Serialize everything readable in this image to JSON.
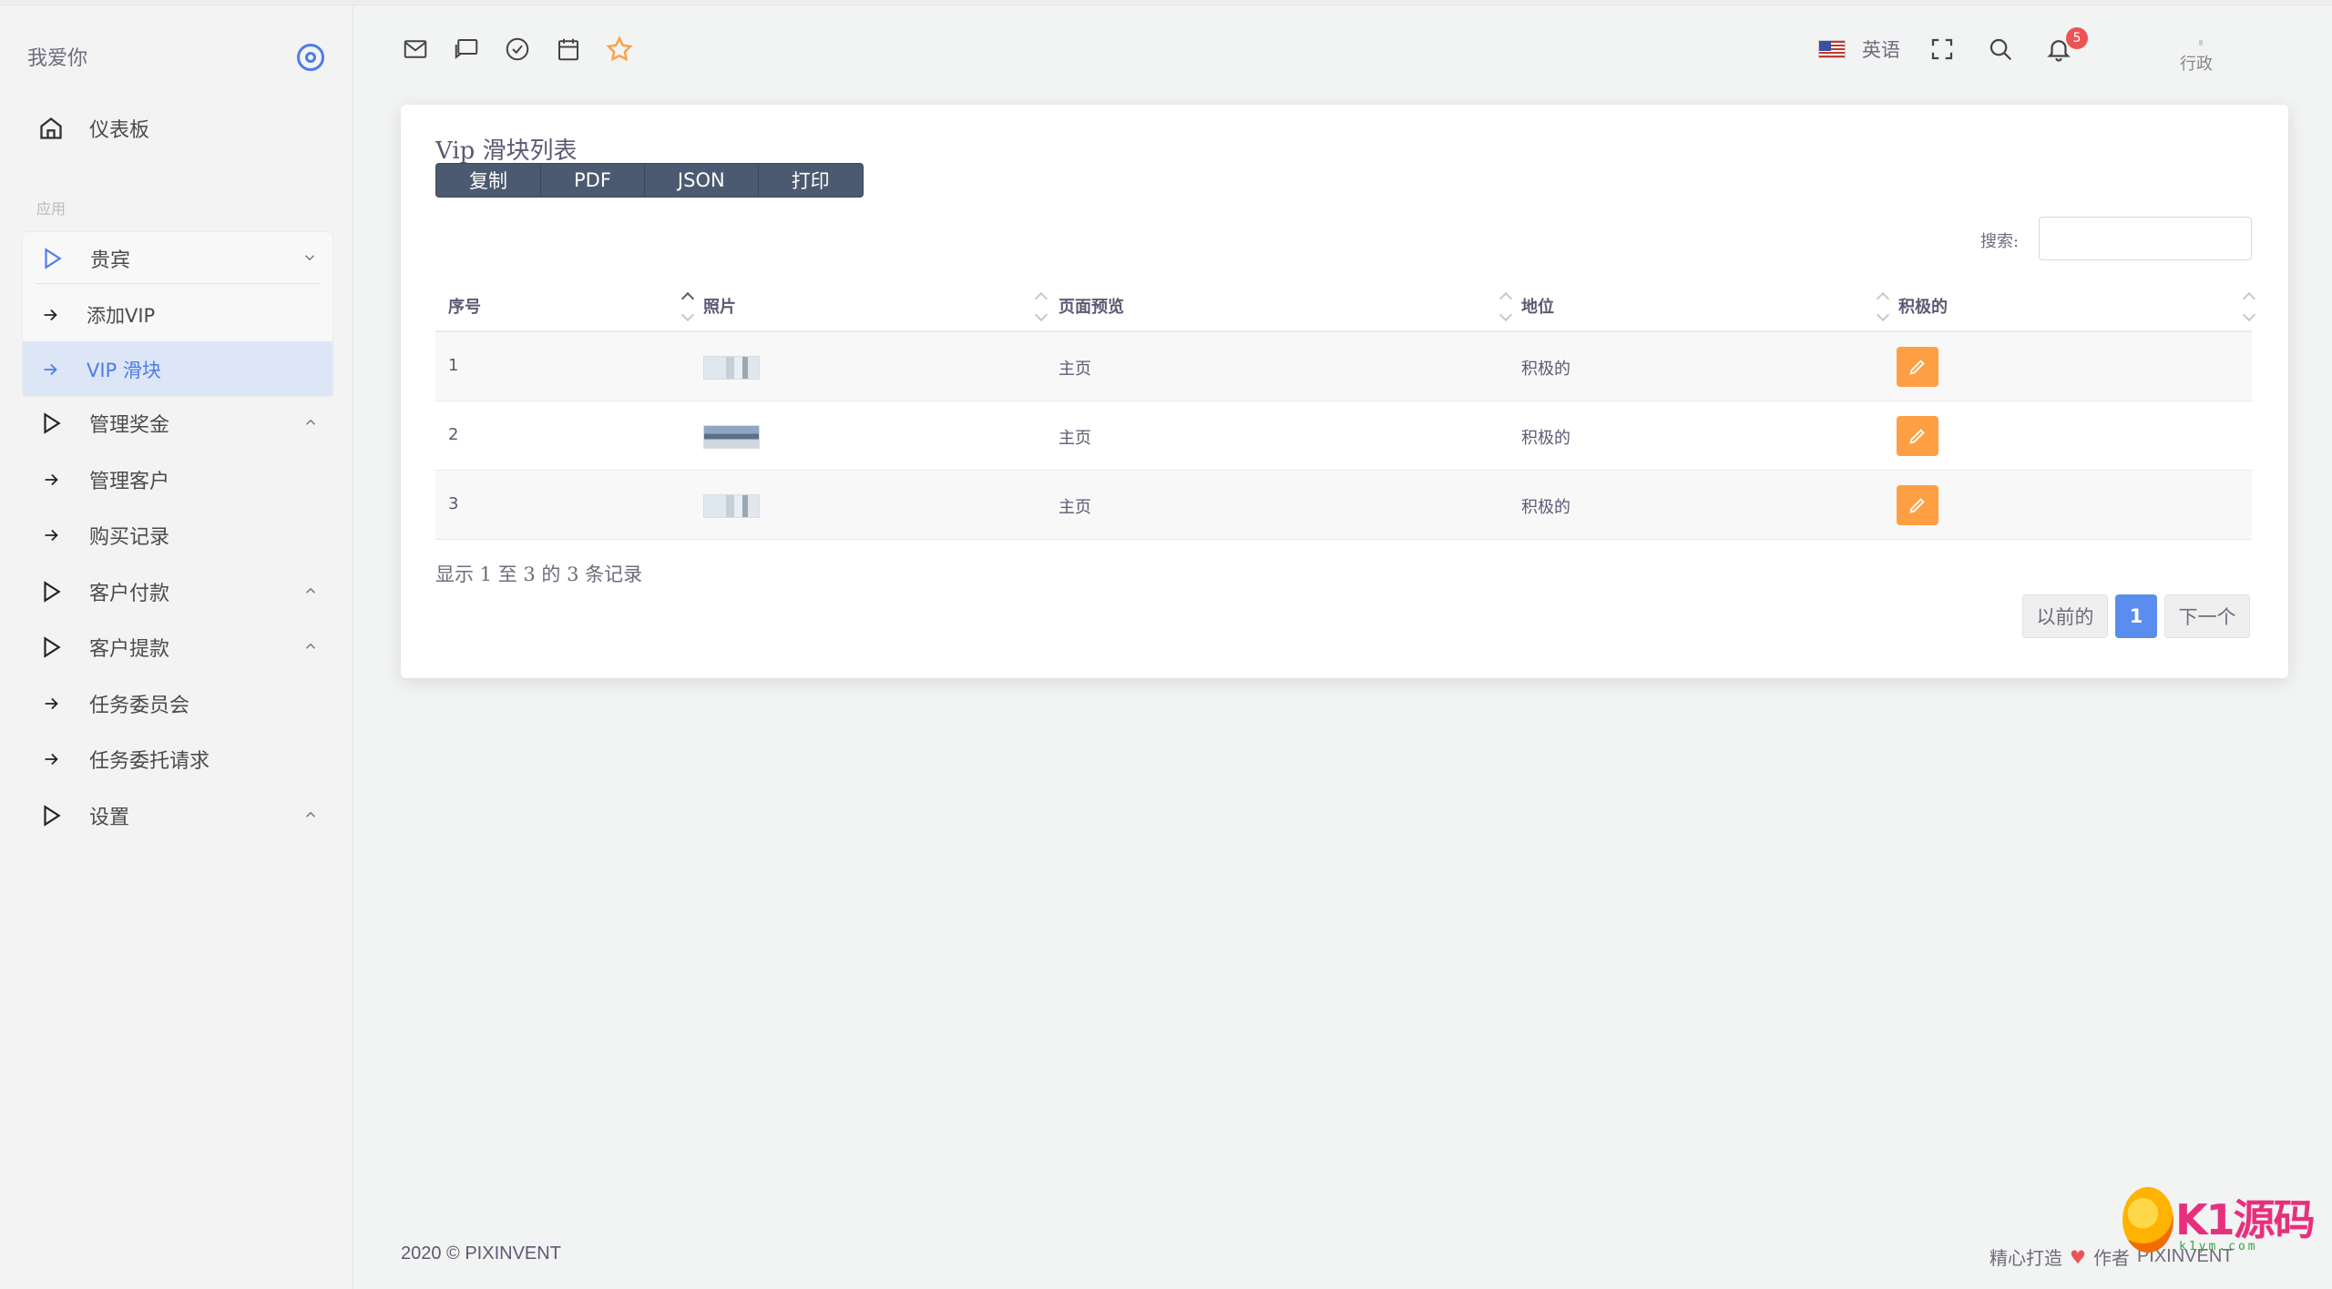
{
  "sidebar": {
    "brand": "我爱你",
    "dashboard": "仪表板",
    "section": "应用",
    "vip_group": "贵宾",
    "vip_add": "添加VIP",
    "vip_slider": "VIP 滑块",
    "items": [
      {
        "label": "管理奖金"
      },
      {
        "label": "管理客户"
      },
      {
        "label": "购买记录"
      },
      {
        "label": "客户付款"
      },
      {
        "label": "客户提款"
      },
      {
        "label": "任务委员会"
      },
      {
        "label": "任务委托请求"
      },
      {
        "label": "设置"
      }
    ]
  },
  "header": {
    "icons": [
      "mail-icon",
      "chat-icon",
      "check-circle-icon",
      "calendar-icon",
      "star-icon"
    ],
    "language": "英语",
    "notification_count": "5",
    "user": "行政"
  },
  "card": {
    "title": "Vip 滑块列表",
    "buttons": [
      "复制",
      "PDF",
      "JSON",
      "打印"
    ],
    "search_label": "搜索:",
    "search_value": "",
    "columns": [
      "序号",
      "照片",
      "页面预览",
      "地位",
      "积极的"
    ],
    "rows": [
      {
        "id": "1",
        "photo": "thumb-a",
        "page": "主页",
        "status": "积极的"
      },
      {
        "id": "2",
        "photo": "thumb-b",
        "page": "主页",
        "status": "积极的"
      },
      {
        "id": "3",
        "photo": "thumb-a",
        "page": "主页",
        "status": "积极的"
      }
    ],
    "info": "显示 1 至 3 的 3 条记录",
    "pager": {
      "prev": "以前的",
      "current": "1",
      "next": "下一个"
    }
  },
  "footer": {
    "copyright": "2020 © PIXINVENT",
    "made_with": "精心打造",
    "by": "作者",
    "brand": "PIXINVENT",
    "watermark": "K1源码",
    "watermark_sub": "k1ym.com"
  },
  "colors": {
    "accent": "#4d7ce8",
    "edit": "#ff9f43",
    "badge": "#ea5455",
    "btn_group": "#4b5a70"
  }
}
